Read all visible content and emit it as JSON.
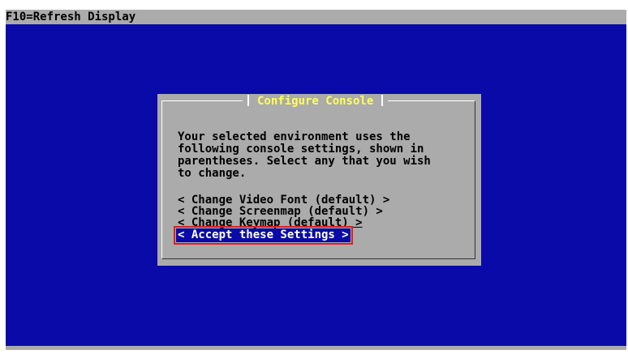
{
  "topbar": {
    "text": "F10=Refresh Display"
  },
  "dialog": {
    "title": "Configure Console",
    "message_lines": [
      "Your selected environment uses the",
      "following console settings, shown in",
      "parentheses. Select any that you wish",
      "to change."
    ],
    "options": [
      {
        "label": "< Change Video Font (default) >",
        "selected": false
      },
      {
        "label": "< Change Screenmap (default) >",
        "selected": false
      },
      {
        "label": "< Change Keymap (default) >",
        "selected": false
      },
      {
        "label": "< Accept these Settings >",
        "selected": true
      }
    ]
  },
  "colors": {
    "background_blue": "#0a0aa8",
    "dialog_gray": "#ababab",
    "title_yellow": "#ffff55",
    "highlight_red": "#e01e1e"
  }
}
